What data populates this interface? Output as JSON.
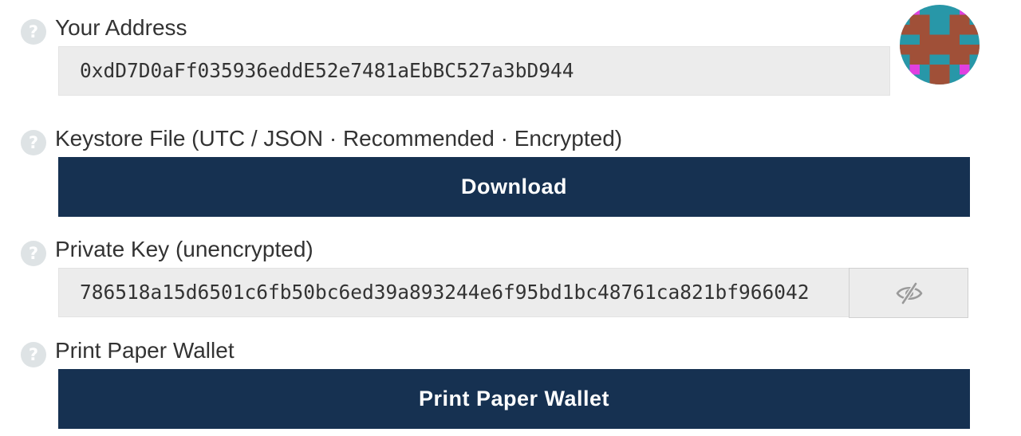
{
  "address_section": {
    "help_icon": "question-mark-icon",
    "label": "Your Address",
    "value": "0xdD7D0aFf035936eddE52e7481aEbBC527a3bD944",
    "avatar": "identicon-avatar"
  },
  "keystore_section": {
    "help_icon": "question-mark-icon",
    "label": "Keystore File (UTC / JSON · Recommended · Encrypted)",
    "button_label": "Download"
  },
  "private_key_section": {
    "help_icon": "question-mark-icon",
    "label": "Private Key (unencrypted)",
    "value": "786518a15d6501c6fb50bc6ed39a893244e6f95bd1bc48761ca821bf966042",
    "toggle_icon": "eye-slash-icon"
  },
  "paper_wallet_section": {
    "help_icon": "question-mark-icon",
    "label": "Print Paper Wallet",
    "button_label": "Print Paper Wallet"
  },
  "colors": {
    "button_bg": "#163151",
    "field_bg": "#ececec",
    "help_icon_bg": "#dee3e5",
    "identicon": [
      "#2897a8",
      "#a05038",
      "#e040e0"
    ]
  },
  "help_glyph": "?"
}
